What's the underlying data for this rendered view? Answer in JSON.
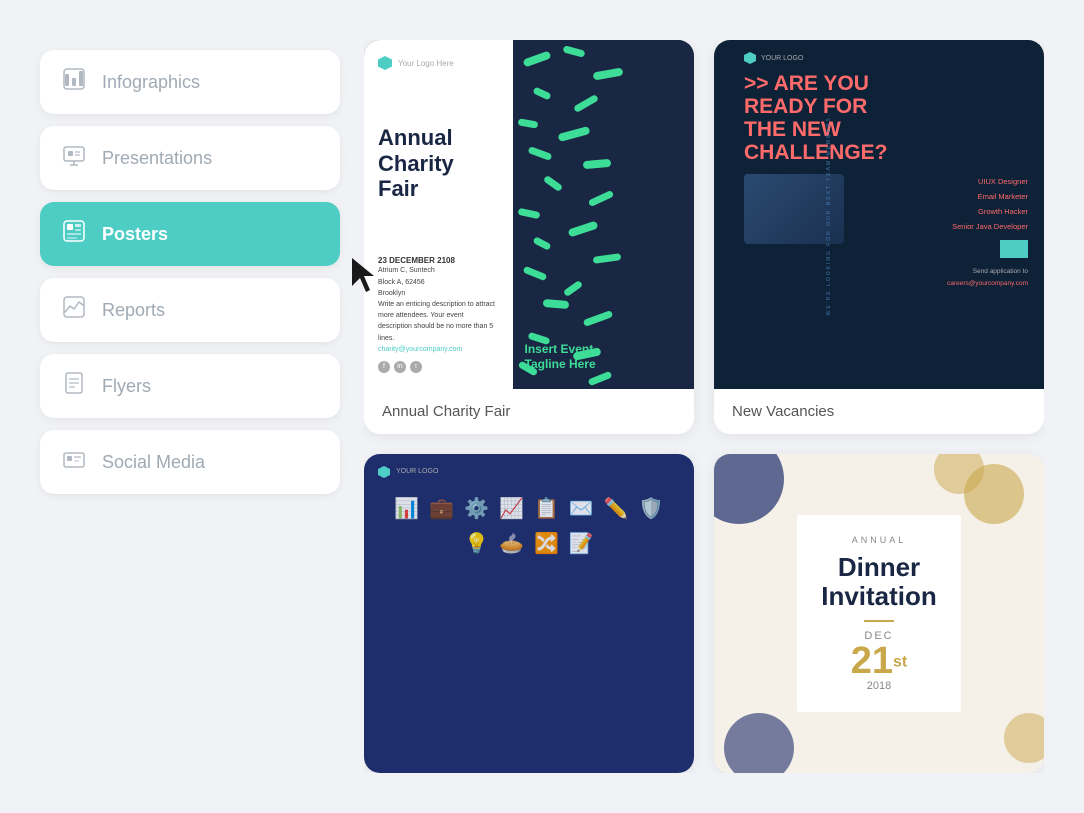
{
  "sidebar": {
    "items": [
      {
        "id": "infographics",
        "label": "Infographics",
        "icon": "📊",
        "active": false
      },
      {
        "id": "presentations",
        "label": "Presentations",
        "icon": "🖼",
        "active": false
      },
      {
        "id": "posters",
        "label": "Posters",
        "icon": "🖼",
        "active": true
      },
      {
        "id": "reports",
        "label": "Reports",
        "icon": "📈",
        "active": false
      },
      {
        "id": "flyers",
        "label": "Flyers",
        "icon": "📋",
        "active": false
      },
      {
        "id": "social-media",
        "label": "Social Media",
        "icon": "📊",
        "active": false
      }
    ]
  },
  "cards": [
    {
      "id": "annual-charity-fair",
      "label": "Annual Charity Fair",
      "title": "Annual Charity Fair",
      "subtitle": "Insert Event Tagline Here",
      "date": "23 DECEMBER 2108",
      "venue": "Atrium C, Suntech\nBlock A, 62456\nBrooklyn",
      "description": "Write an enticing description to attract more attendees. Your event description should be no more than 5 lines.",
      "email": "charity@yourcompany.com",
      "logo_text": "Your Logo Here"
    },
    {
      "id": "new-vacancies",
      "label": "New Vacancies",
      "headline": ">> ARE YOU READY FOR THE NEW CHALLENGE?",
      "subtitle": "WE'RE LOOKING FOR OUR NEXT TEAM MEMBERS.",
      "jobs": [
        "UIUX Designer",
        "Email Marketer",
        "Growth Hacker",
        "Senior Java Developer"
      ],
      "cta": "Send application to",
      "email": "careers@yourcompany.com"
    },
    {
      "id": "business-poster",
      "label": "",
      "logo_text": "YOUR LOGO"
    },
    {
      "id": "dinner-invitation",
      "label": "",
      "annual": "ANNUAL",
      "title": "Dinner\nInvitation",
      "dec": "DEC",
      "date": "21",
      "sup": "st",
      "year": "2018"
    }
  ],
  "colors": {
    "teal": "#4ecdc4",
    "dark_navy": "#1a2744",
    "green": "#3ddc97",
    "coral": "#ff6b6b",
    "gold": "#c9a84c",
    "sidebar_bg": "#f0f2f5"
  }
}
